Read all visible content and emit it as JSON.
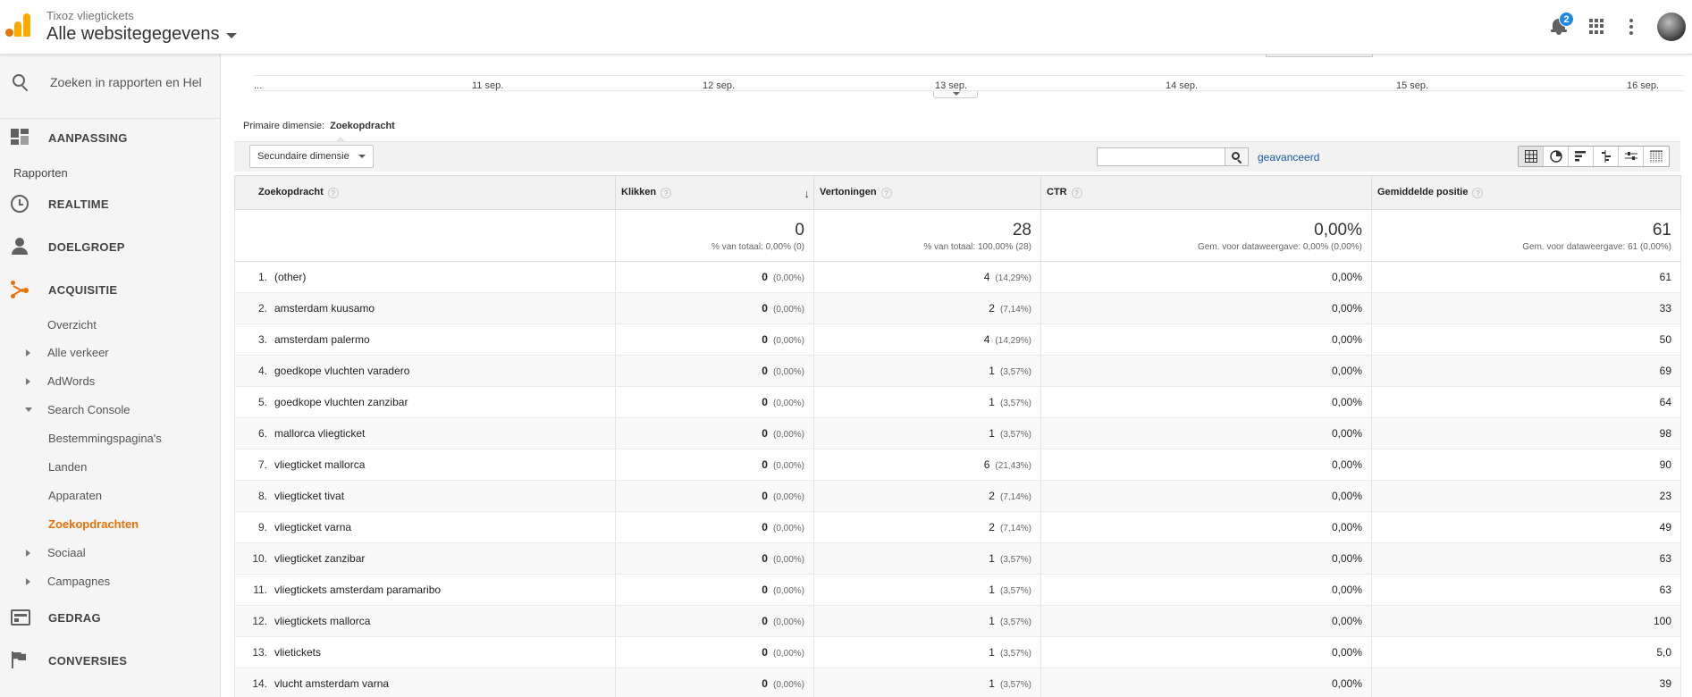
{
  "header": {
    "account_sub": "Tixoz vliegtickets",
    "account_main": "Alle websitegegevens",
    "notification_count": "2"
  },
  "sidebar": {
    "search_placeholder": "Zoeken in rapporten en Hel",
    "customization": "AANPASSING",
    "reports_label": "Rapporten",
    "realtime": "REALTIME",
    "audience": "DOELGROEP",
    "acquisition": "ACQUISITIE",
    "acq_items": {
      "overview": "Overzicht",
      "all_traffic": "Alle verkeer",
      "adwords": "AdWords",
      "search_console": "Search Console",
      "landing_pages": "Bestemmingspagina's",
      "countries": "Landen",
      "devices": "Apparaten",
      "queries": "Zoekopdrachten",
      "social": "Sociaal",
      "campaigns": "Campagnes"
    },
    "behavior": "GEDRAG",
    "conversions": "CONVERSIES"
  },
  "timeline": {
    "labels": [
      "...",
      "11 sep.",
      "12 sep.",
      "13 sep.",
      "14 sep.",
      "15 sep.",
      "16 sep."
    ]
  },
  "dimension": {
    "primary_label": "Primaire dimensie:",
    "primary_value": "Zoekopdracht",
    "secondary_button": "Secundaire dimensie",
    "advanced_link": "geavanceerd"
  },
  "table": {
    "columns": [
      "Zoekopdracht",
      "Klikken",
      "Vertoningen",
      "CTR",
      "Gemiddelde positie"
    ],
    "help_glyph": "?",
    "sort_glyph": "↓",
    "totals": {
      "clicks": "0",
      "clicks_sub": "% van totaal: 0,00% (0)",
      "impressions": "28",
      "impressions_sub": "% van totaal: 100,00% (28)",
      "ctr": "0,00%",
      "ctr_sub": "Gem. voor dataweergave: 0,00% (0,00%)",
      "position": "61",
      "position_sub": "Gem. voor dataweergave: 61 (0,00%)"
    },
    "rows": [
      {
        "idx": "1.",
        "query": "(other)",
        "clicks": "0",
        "clicks_pct": "(0,00%)",
        "impr": "4",
        "impr_pct": "(14,29%)",
        "ctr": "0,00%",
        "pos": "61"
      },
      {
        "idx": "2.",
        "query": "amsterdam kuusamo",
        "clicks": "0",
        "clicks_pct": "(0,00%)",
        "impr": "2",
        "impr_pct": "(7,14%)",
        "ctr": "0,00%",
        "pos": "33"
      },
      {
        "idx": "3.",
        "query": "amsterdam palermo",
        "clicks": "0",
        "clicks_pct": "(0,00%)",
        "impr": "4",
        "impr_pct": "(14,29%)",
        "ctr": "0,00%",
        "pos": "50"
      },
      {
        "idx": "4.",
        "query": "goedkope vluchten varadero",
        "clicks": "0",
        "clicks_pct": "(0,00%)",
        "impr": "1",
        "impr_pct": "(3,57%)",
        "ctr": "0,00%",
        "pos": "69"
      },
      {
        "idx": "5.",
        "query": "goedkope vluchten zanzibar",
        "clicks": "0",
        "clicks_pct": "(0,00%)",
        "impr": "1",
        "impr_pct": "(3,57%)",
        "ctr": "0,00%",
        "pos": "64"
      },
      {
        "idx": "6.",
        "query": "mallorca vliegticket",
        "clicks": "0",
        "clicks_pct": "(0,00%)",
        "impr": "1",
        "impr_pct": "(3,57%)",
        "ctr": "0,00%",
        "pos": "98"
      },
      {
        "idx": "7.",
        "query": "vliegticket mallorca",
        "clicks": "0",
        "clicks_pct": "(0,00%)",
        "impr": "6",
        "impr_pct": "(21,43%)",
        "ctr": "0,00%",
        "pos": "90"
      },
      {
        "idx": "8.",
        "query": "vliegticket tivat",
        "clicks": "0",
        "clicks_pct": "(0,00%)",
        "impr": "2",
        "impr_pct": "(7,14%)",
        "ctr": "0,00%",
        "pos": "23"
      },
      {
        "idx": "9.",
        "query": "vliegticket varna",
        "clicks": "0",
        "clicks_pct": "(0,00%)",
        "impr": "2",
        "impr_pct": "(7,14%)",
        "ctr": "0,00%",
        "pos": "49"
      },
      {
        "idx": "10.",
        "query": "vliegticket zanzibar",
        "clicks": "0",
        "clicks_pct": "(0,00%)",
        "impr": "1",
        "impr_pct": "(3,57%)",
        "ctr": "0,00%",
        "pos": "63"
      },
      {
        "idx": "11.",
        "query": "vliegtickets amsterdam paramaribo",
        "clicks": "0",
        "clicks_pct": "(0,00%)",
        "impr": "1",
        "impr_pct": "(3,57%)",
        "ctr": "0,00%",
        "pos": "63"
      },
      {
        "idx": "12.",
        "query": "vliegtickets mallorca",
        "clicks": "0",
        "clicks_pct": "(0,00%)",
        "impr": "1",
        "impr_pct": "(3,57%)",
        "ctr": "0,00%",
        "pos": "100"
      },
      {
        "idx": "13.",
        "query": "vlietickets",
        "clicks": "0",
        "clicks_pct": "(0,00%)",
        "impr": "1",
        "impr_pct": "(3,57%)",
        "ctr": "0,00%",
        "pos": "5,0"
      },
      {
        "idx": "14.",
        "query": "vlucht amsterdam varna",
        "clicks": "0",
        "clicks_pct": "(0,00%)",
        "impr": "1",
        "impr_pct": "(3,57%)",
        "ctr": "0,00%",
        "pos": "39"
      }
    ]
  },
  "colors": {
    "accent": "#e8710a",
    "link": "#1a5aa8",
    "badge": "#1e88e5"
  }
}
